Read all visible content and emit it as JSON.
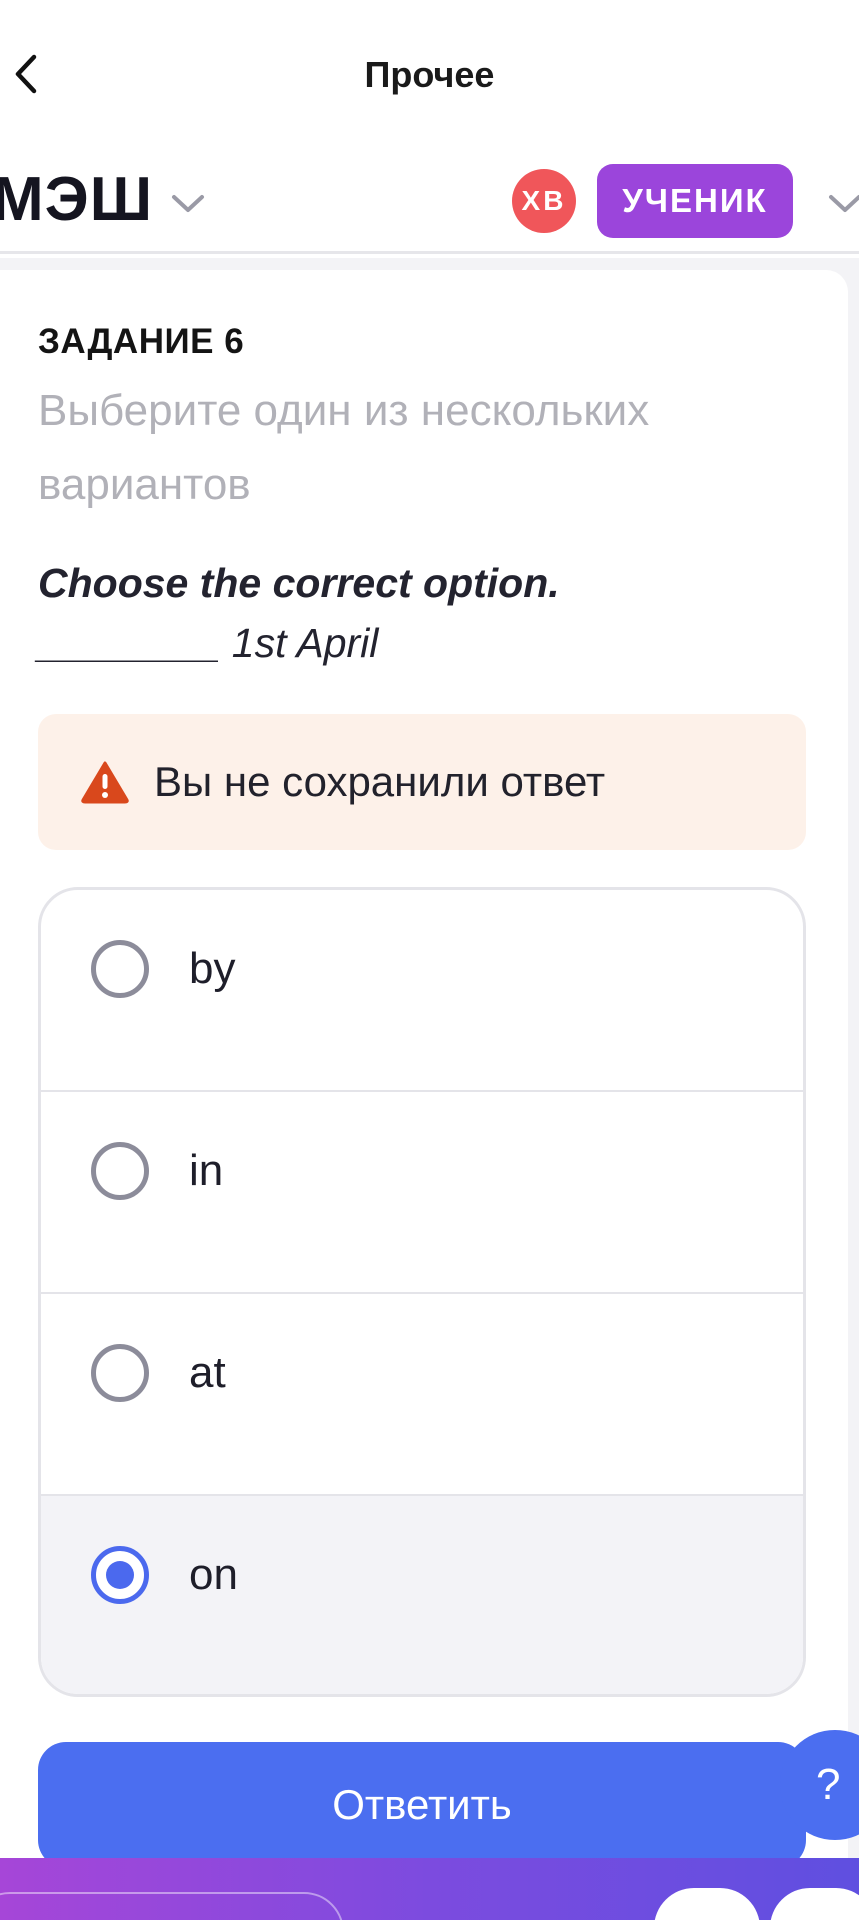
{
  "navbar": {
    "title": "Прочее",
    "back_icon": "chevron-left-icon"
  },
  "appbar": {
    "logo": "МЭШ",
    "logo_menu_icon": "chevron-down-icon",
    "avatar_initials": "ХВ",
    "role": "УЧЕНИК",
    "role_menu_icon": "chevron-down-icon"
  },
  "task": {
    "label": "ЗАДАНИЕ 6",
    "instruction": "Выберите один из нескольких вариантов",
    "question": "Choose the correct option.",
    "gap": "________ 1st April"
  },
  "warning": {
    "text": "Вы не сохранили ответ",
    "icon": "warning-icon",
    "color": "#d9481c",
    "background": "#fdf1e9"
  },
  "options": [
    {
      "label": "by",
      "selected": false
    },
    {
      "label": "in",
      "selected": false
    },
    {
      "label": "at",
      "selected": false
    },
    {
      "label": "on",
      "selected": true
    }
  ],
  "submit": {
    "label": "Ответить"
  },
  "help": {
    "label": "?"
  },
  "colors": {
    "accent": "#4b6ef0",
    "role_badge": "#9b45db",
    "avatar": "#f0565a"
  }
}
